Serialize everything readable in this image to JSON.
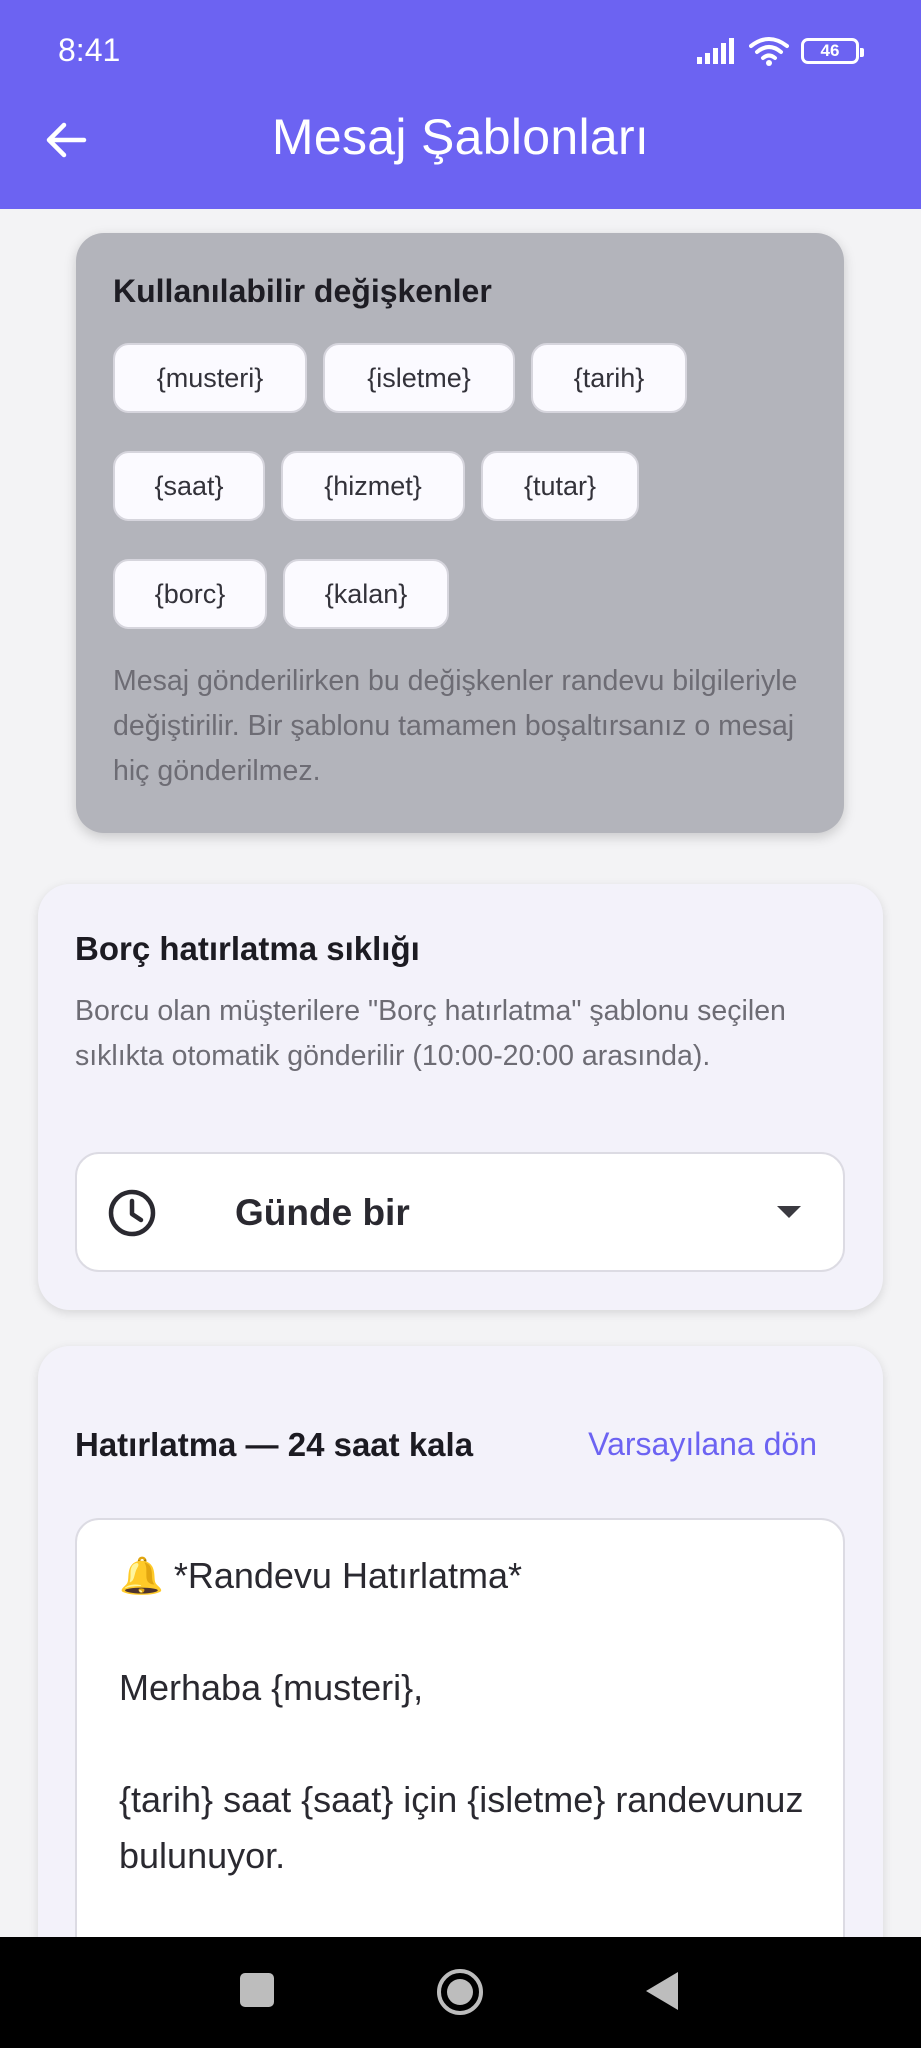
{
  "status_bar": {
    "time": "8:41",
    "battery": "46"
  },
  "header": {
    "title": "Mesaj Şablonları",
    "back_icon": "arrow-left-icon",
    "background_color": "#6c63f2"
  },
  "variables": {
    "title": "Kullanılabilir değişkenler",
    "chips": [
      "{musteri}",
      "{isletme}",
      "{tarih}",
      "{saat}",
      "{hizmet}",
      "{tutar}",
      "{borc}",
      "{kalan}"
    ],
    "note": "Mesaj gönderilirken bu değişkenler randevu bilgileriyle değiştirilir. Bir şablonu tamamen boşaltırsanız o mesaj hiç gönderilmez."
  },
  "debt_reminder": {
    "title": "Borç hatırlatma sıklığı",
    "description": "Borcu olan müşterilere \"Borç hatırlatma\" şablonu seçilen sıklıkta otomatik gönderilir (10:00-20:00 arasında).",
    "selected_value": "Günde bir",
    "icon": "clock-icon"
  },
  "reminder_template": {
    "title": "Hatırlatma — 24 saat kala",
    "reset_label": "Varsayılana dön",
    "text": "🔔 *Randevu Hatırlatma*\n\nMerhaba {musteri},\n\n{tarih} saat {saat} için {isletme} randevunuz bulunuyor."
  },
  "colors": {
    "accent": "#6c63f2",
    "variables_card": "#b3b4bb",
    "card_bg": "#f3f2fa"
  }
}
